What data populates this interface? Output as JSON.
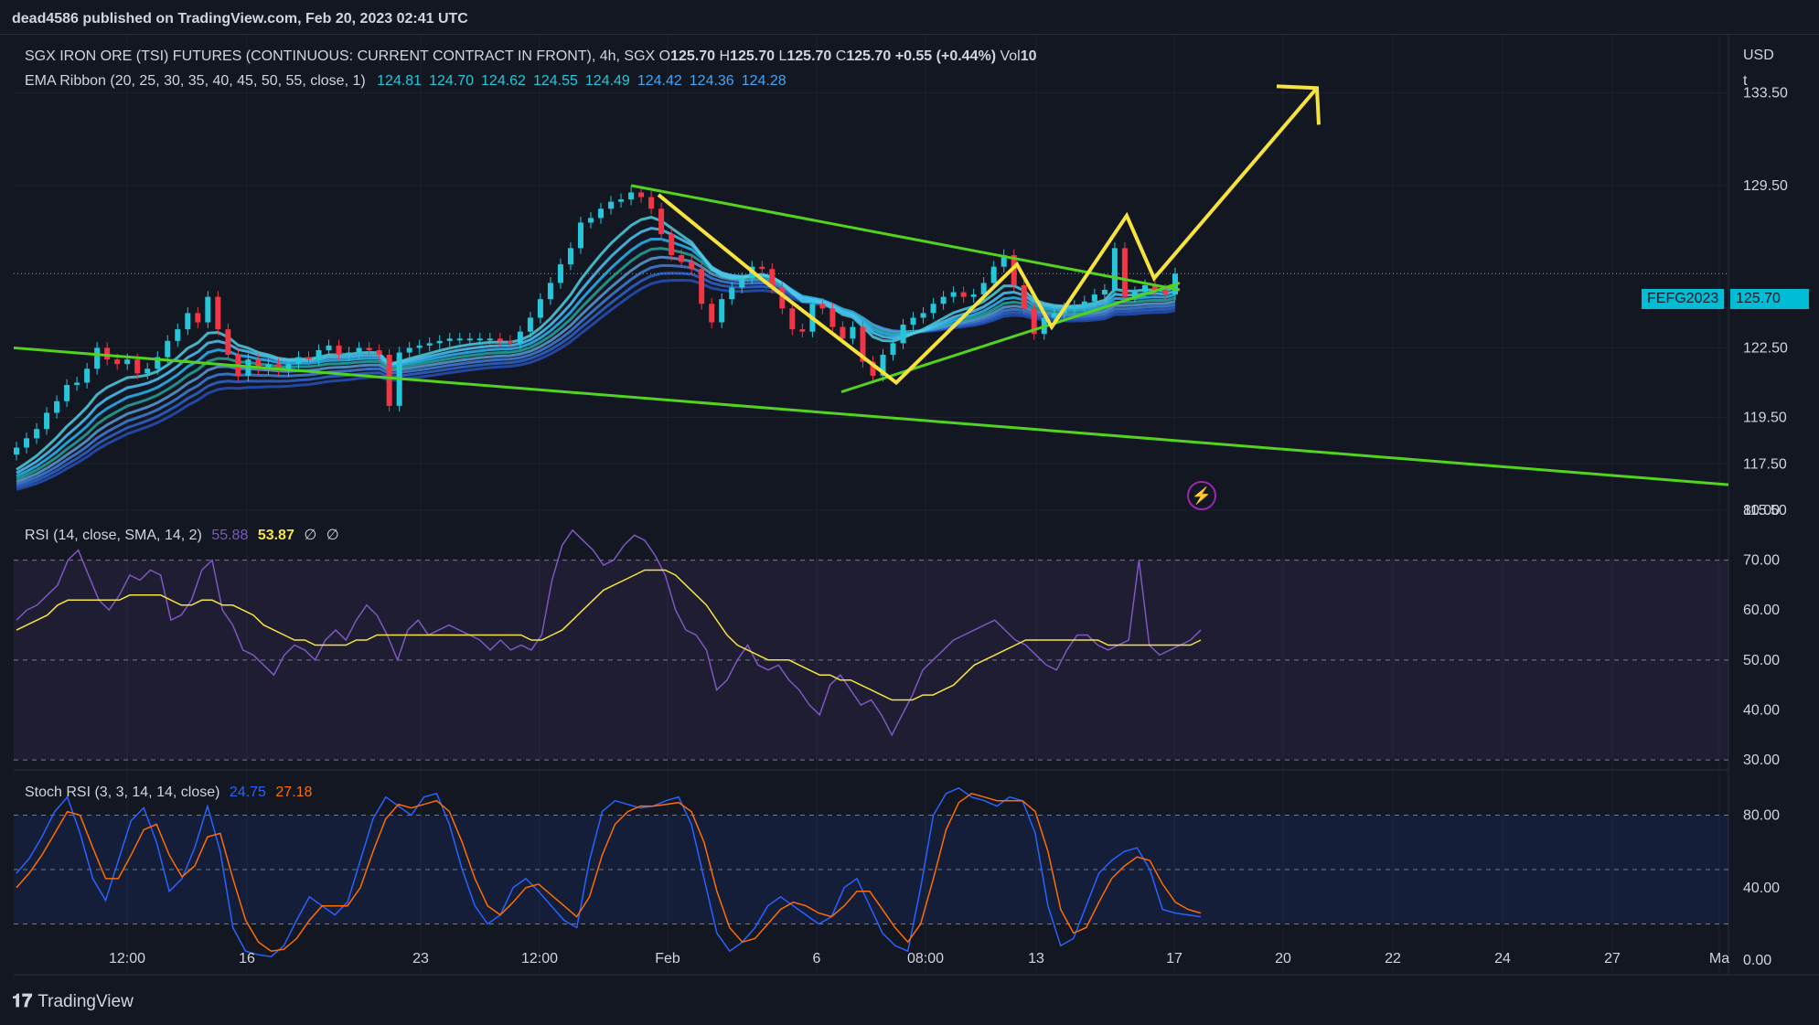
{
  "header": {
    "publisher": "dead4586 published on TradingView.com, Feb 20, 2023 02:41 UTC"
  },
  "main_legend": {
    "symbol": "SGX IRON ORE (TSI) FUTURES (CONTINUOUS: CURRENT CONTRACT IN FRONT), 4h, SGX",
    "o_label": "O",
    "o_value": "125.70",
    "h_label": "H",
    "h_value": "125.70",
    "l_label": "L",
    "l_value": "125.70",
    "c_label": "C",
    "c_value": "125.70",
    "change": "+0.55 (+0.44%)",
    "vol_label": "Vol",
    "vol_value": "10"
  },
  "ema_legend": {
    "name": "EMA Ribbon (20, 25, 30, 35, 40, 45, 50, 55, close, 1)",
    "values": [
      "124.81",
      "124.70",
      "124.62",
      "124.55",
      "124.49",
      "124.42",
      "124.36",
      "124.28"
    ],
    "colors": [
      "#26c6da",
      "#26c6da",
      "#26c6da",
      "#26c6da",
      "#26c6da",
      "#42a5f5",
      "#42a5f5",
      "#42a5f5"
    ]
  },
  "rsi_legend": {
    "name": "RSI (14, close, SMA, 14, 2)",
    "rsi": "55.88",
    "sma": "53.87",
    "na1": "∅",
    "na2": "∅"
  },
  "stoch_legend": {
    "name": "Stoch RSI (3, 3, 14, 14, close)",
    "k": "24.75",
    "d": "27.18"
  },
  "price_axis": {
    "currency": "USD",
    "unit": "t"
  },
  "last_price_badge": {
    "symbol": "FEFG2023",
    "price": "125.70"
  },
  "brand": {
    "name": "TradingView"
  },
  "colors": {
    "bg": "#131722",
    "up": "#26c6da",
    "down": "#f23645",
    "trend": "#52d41f",
    "drawing": "#f7e33d",
    "rsi": "#7e57c2",
    "rsi_ma": "#f7e33d",
    "stoch_k": "#2962ff",
    "stoch_d": "#ff6d00"
  },
  "chart_data": [
    {
      "type": "candlestick",
      "title": "SGX IRON ORE (TSI) FUTURES (CONTINUOUS: CURRENT CONTRACT IN FRONT), 4h, SGX",
      "x_ticks": [
        "12:00",
        "16",
        "23",
        "12:00",
        "Feb",
        "6",
        "08:00",
        "13",
        "17",
        "20",
        "22",
        "24",
        "27",
        "Ma"
      ],
      "y_ticks": [
        "133.50",
        "129.50",
        "125.70",
        "122.50",
        "119.50",
        "117.50",
        "115.50"
      ],
      "ylim": [
        115.5,
        136
      ],
      "close_series": [
        118.2,
        118.6,
        119.0,
        119.7,
        120.2,
        120.9,
        121.0,
        121.6,
        122.5,
        122.0,
        121.8,
        122.0,
        121.4,
        121.6,
        122.1,
        122.8,
        123.3,
        124.0,
        123.6,
        124.7,
        123.3,
        122.2,
        121.3,
        122.0,
        121.6,
        121.8,
        121.5,
        121.8,
        122.1,
        122.0,
        122.4,
        122.6,
        122.2,
        122.3,
        122.5,
        122.4,
        122.2,
        120.0,
        122.3,
        122.5,
        122.6,
        122.7,
        122.8,
        122.9,
        122.9,
        122.9,
        122.9,
        122.9,
        122.8,
        122.7,
        123.2,
        123.8,
        124.6,
        125.3,
        126.1,
        126.8,
        127.9,
        128.1,
        128.5,
        128.8,
        128.9,
        129.2,
        129.0,
        128.5,
        127.4,
        126.5,
        126.2,
        125.9,
        124.4,
        123.6,
        124.6,
        125.1,
        125.5,
        126.0,
        125.9,
        125.1,
        124.2,
        123.3,
        123.2,
        124.4,
        124.2,
        123.4,
        122.9,
        123.4,
        121.9,
        121.3,
        122.2,
        122.7,
        123.5,
        123.8,
        124.0,
        124.4,
        124.7,
        124.9,
        124.7,
        124.8,
        125.3,
        126.0,
        126.5,
        125.2,
        124.2,
        123.1,
        123.8,
        124.0,
        124.2,
        124.3,
        124.5,
        124.8,
        125.0,
        126.8,
        124.7,
        124.9,
        125.2,
        125.0,
        124.8,
        125.7
      ],
      "ema_ribbon": {
        "periods": [
          20,
          25,
          30,
          35,
          40,
          45,
          50,
          55
        ],
        "last_values": [
          124.81,
          124.7,
          124.62,
          124.55,
          124.49,
          124.42,
          124.36,
          124.28
        ]
      },
      "last_price": 125.7
    },
    {
      "type": "line",
      "title": "RSI (14, close, SMA, 14, 2)",
      "y_ticks": [
        "80.00",
        "70.00",
        "60.00",
        "50.00",
        "40.00",
        "30.00"
      ],
      "ylim": [
        28,
        80
      ],
      "band": [
        30,
        70
      ],
      "series": [
        {
          "values": [
            58,
            60,
            61,
            63,
            65,
            70,
            72,
            67,
            62,
            60,
            63,
            67,
            66,
            68,
            67,
            58,
            59,
            62,
            68,
            70,
            60,
            57,
            52,
            51,
            49,
            47,
            51,
            53,
            52,
            50,
            54,
            56,
            54,
            58,
            61,
            59,
            55,
            50,
            56,
            58,
            55,
            56,
            57,
            56,
            55,
            54,
            52,
            54,
            52,
            53,
            52,
            55,
            66,
            73,
            76,
            74,
            72,
            69,
            70,
            73,
            75,
            74,
            71,
            67,
            60,
            56,
            55,
            52,
            44,
            46,
            50,
            53,
            49,
            48,
            49,
            46,
            44,
            41,
            39,
            45,
            47,
            44,
            41,
            42,
            39,
            35,
            39,
            43,
            48,
            50,
            52,
            54,
            55,
            56,
            57,
            58,
            56,
            54,
            53,
            51,
            49,
            48,
            52,
            55,
            55,
            53,
            52,
            53,
            54,
            70,
            53,
            51,
            52,
            53,
            54,
            56
          ]
        },
        {
          "values": [
            56,
            57,
            58,
            59,
            61,
            62,
            62,
            62,
            62,
            62,
            62,
            63,
            63,
            63,
            63,
            62,
            61,
            61,
            62,
            62,
            61,
            61,
            60,
            59,
            57,
            56,
            55,
            54,
            54,
            53,
            53,
            53,
            53,
            54,
            54,
            55,
            55,
            55,
            55,
            55,
            55,
            55,
            55,
            55,
            55,
            55,
            55,
            55,
            55,
            55,
            54,
            54,
            55,
            56,
            58,
            60,
            62,
            64,
            65,
            66,
            67,
            68,
            68,
            68,
            67,
            65,
            63,
            61,
            58,
            55,
            53,
            52,
            51,
            50,
            50,
            50,
            49,
            48,
            47,
            47,
            46,
            46,
            45,
            44,
            43,
            42,
            42,
            42,
            43,
            43,
            44,
            45,
            47,
            49,
            50,
            51,
            52,
            53,
            54,
            54,
            54,
            54,
            54,
            54,
            54,
            54,
            53,
            53,
            53,
            53,
            53,
            53,
            53,
            53,
            53,
            54
          ]
        }
      ]
    },
    {
      "type": "line",
      "title": "Stoch RSI (3, 3, 14, 14, close)",
      "y_ticks": [
        "80.00",
        "40.00",
        "0.00"
      ],
      "ylim": [
        -8,
        105
      ],
      "band": [
        20,
        80
      ],
      "series": [
        {
          "values": [
            48,
            56,
            68,
            82,
            90,
            70,
            45,
            33,
            55,
            77,
            84,
            65,
            38,
            45,
            62,
            85,
            60,
            18,
            5,
            3,
            2,
            8,
            22,
            35,
            30,
            25,
            32,
            55,
            78,
            90,
            85,
            80,
            90,
            92,
            75,
            50,
            30,
            20,
            25,
            40,
            45,
            38,
            30,
            22,
            18,
            55,
            82,
            88,
            86,
            84,
            85,
            88,
            90,
            75,
            45,
            15,
            5,
            10,
            18,
            30,
            35,
            30,
            25,
            20,
            24,
            40,
            45,
            30,
            15,
            8,
            5,
            40,
            80,
            92,
            95,
            90,
            88,
            85,
            90,
            88,
            70,
            30,
            8,
            12,
            30,
            48,
            55,
            60,
            62,
            50,
            28,
            26,
            25,
            24
          ]
        },
        {
          "values": [
            40,
            48,
            58,
            70,
            82,
            80,
            62,
            45,
            45,
            58,
            72,
            75,
            58,
            46,
            52,
            68,
            70,
            45,
            22,
            10,
            5,
            6,
            12,
            22,
            30,
            30,
            30,
            40,
            60,
            78,
            86,
            84,
            86,
            88,
            82,
            65,
            45,
            30,
            25,
            32,
            40,
            42,
            36,
            30,
            24,
            35,
            58,
            75,
            82,
            85,
            85,
            86,
            87,
            82,
            65,
            38,
            18,
            10,
            12,
            20,
            28,
            32,
            30,
            26,
            24,
            30,
            38,
            38,
            28,
            18,
            10,
            20,
            45,
            72,
            87,
            92,
            90,
            88,
            88,
            88,
            82,
            60,
            28,
            15,
            18,
            32,
            45,
            52,
            57,
            55,
            42,
            32,
            28,
            26
          ]
        }
      ]
    }
  ]
}
